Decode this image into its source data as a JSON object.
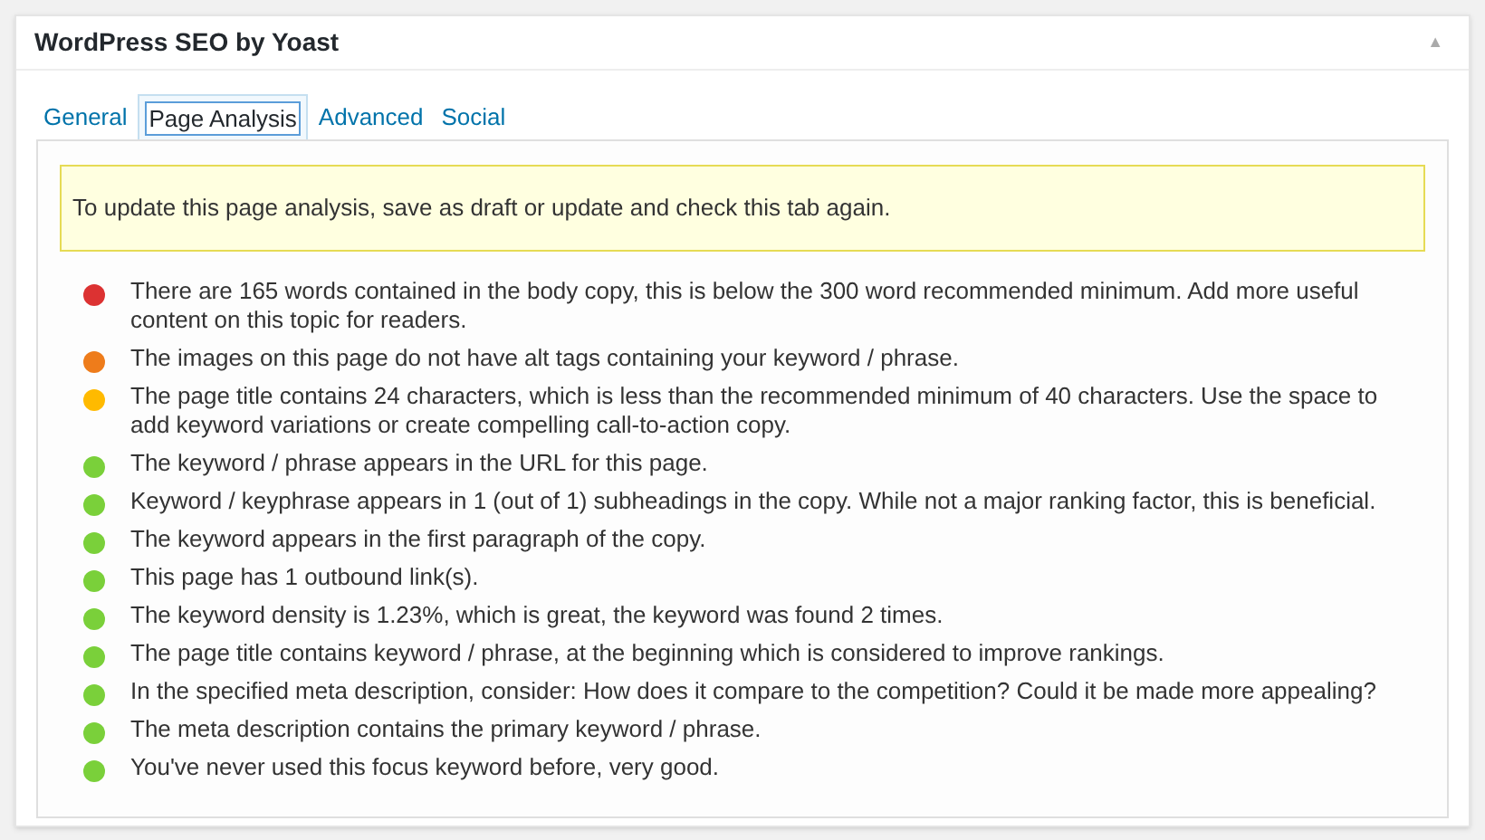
{
  "box": {
    "title": "WordPress SEO by Yoast",
    "toggle": "▲"
  },
  "tabs": [
    {
      "label": "General",
      "selected": false
    },
    {
      "label": "Page Analysis",
      "selected": true
    },
    {
      "label": "Advanced",
      "selected": false
    },
    {
      "label": "Social",
      "selected": false
    }
  ],
  "notice": "To update this page analysis, save as draft or update and check this tab again.",
  "results": [
    {
      "color": "#dc3232",
      "text": "There are 165 words contained in the body copy, this is below the 300 word recommended minimum. Add more useful content on this topic for readers."
    },
    {
      "color": "#ee7c1b",
      "text": "The images on this page do not have alt tags containing your keyword / phrase."
    },
    {
      "color": "#ffba00",
      "text": "The page title contains 24 characters, which is less than the recommended minimum of 40 characters. Use the space to add keyword variations or create compelling call-to-action copy."
    },
    {
      "color": "#7ad03a",
      "text": "The keyword / phrase appears in the URL for this page."
    },
    {
      "color": "#7ad03a",
      "text": "Keyword / keyphrase appears in 1 (out of 1) subheadings in the copy. While not a major ranking factor, this is beneficial."
    },
    {
      "color": "#7ad03a",
      "text": "The keyword appears in the first paragraph of the copy."
    },
    {
      "color": "#7ad03a",
      "text": "This page has 1 outbound link(s)."
    },
    {
      "color": "#7ad03a",
      "text": "The keyword density is 1.23%, which is great, the keyword was found 2 times."
    },
    {
      "color": "#7ad03a",
      "text": "The page title contains keyword / phrase, at the beginning which is considered to improve rankings."
    },
    {
      "color": "#7ad03a",
      "text": "In the specified meta description, consider: How does it compare to the competition? Could it be made more appealing?"
    },
    {
      "color": "#7ad03a",
      "text": "The meta description contains the primary keyword / phrase."
    },
    {
      "color": "#7ad03a",
      "text": "You've never used this focus keyword before, very good."
    }
  ]
}
